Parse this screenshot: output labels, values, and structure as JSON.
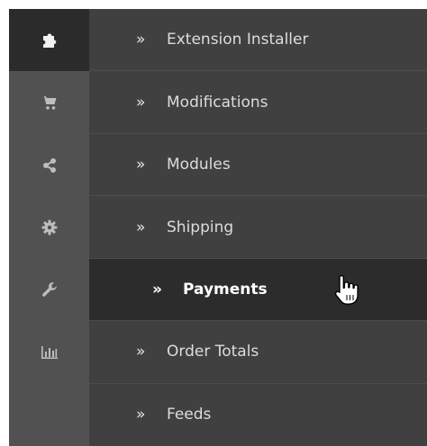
{
  "sidebar": {
    "icons": [
      {
        "name": "puzzle-icon",
        "active": true
      },
      {
        "name": "cart-icon",
        "active": false
      },
      {
        "name": "share-icon",
        "active": false
      },
      {
        "name": "gear-icon",
        "active": false
      },
      {
        "name": "wrench-icon",
        "active": false
      },
      {
        "name": "bar-chart-icon",
        "active": false
      }
    ]
  },
  "menu": {
    "chevron": "»",
    "items": [
      {
        "label": "Extension Installer"
      },
      {
        "label": "Modifications"
      },
      {
        "label": "Modules"
      },
      {
        "label": "Shipping"
      },
      {
        "label": "Payments",
        "selected": true
      },
      {
        "label": "Order Totals"
      },
      {
        "label": "Feeds"
      }
    ]
  },
  "colors": {
    "icon_bar": "#515151",
    "menu_bg": "#404040",
    "selected_bg": "#2c2c2c"
  }
}
